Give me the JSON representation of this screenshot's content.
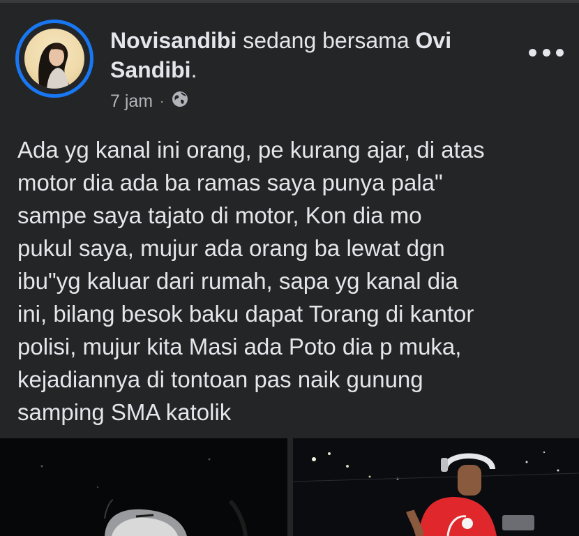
{
  "post": {
    "author": "Novisandibi",
    "connector": " sedang bersama ",
    "tagged_part1": "Ovi",
    "tagged_part2": "Sandibi",
    "period": ".",
    "time": "7 jam",
    "separator": "·",
    "privacy_icon": "globe-icon",
    "menu_icon": "more-options-icon",
    "text_lines": [
      "Ada yg kanal ini orang, pe kurang ajar, di atas",
      "motor dia ada ba ramas saya punya pala\"",
      "sampe saya tajato di motor, Kon dia mo",
      "pukul saya, mujur ada orang ba lewat dgn",
      "ibu\"yg kaluar dari rumah, sapa yg kanal dia",
      "ini, bilang besok baku dapat Torang di kantor",
      "polisi, mujur kita Masi ada Poto dia p muka,",
      "kejadiannya di tontoan pas naik gunung",
      "samping SMA katolik"
    ]
  },
  "colors": {
    "background": "#242526",
    "text": "#e4e6eb",
    "secondary_text": "#b0b3b8",
    "avatar_ring": "#1877f2",
    "shirt": "#e0282c"
  }
}
